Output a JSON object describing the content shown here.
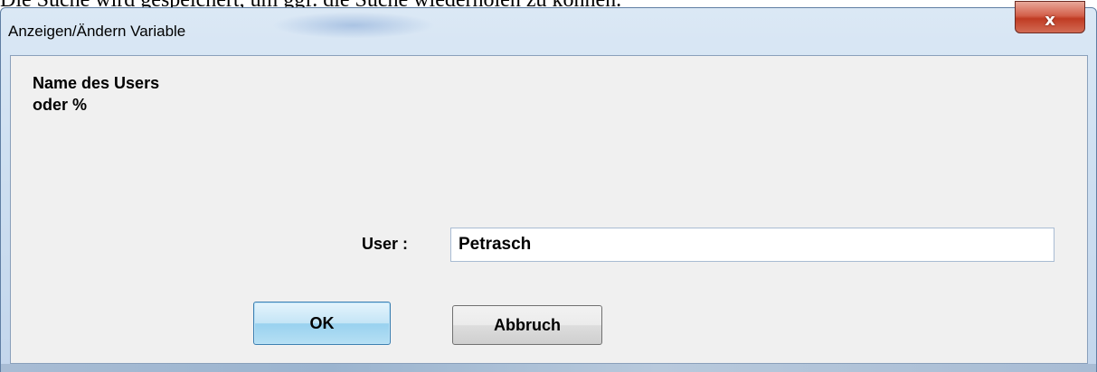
{
  "background": {
    "text": "Die Suche wird gespeichert, um ggf. die Suche wiederholen zu können."
  },
  "window": {
    "title": "Anzeigen/Ändern Variable",
    "close_glyph": "x"
  },
  "dialog": {
    "prompt_line1": "Name des Users",
    "prompt_line2": "oder %",
    "user_label": "User :",
    "user_value": "Petrasch",
    "ok_label": "OK",
    "cancel_label": "Abbruch"
  },
  "colors": {
    "close_button": "#c03b23",
    "ok_button_border": "#3c7fb1",
    "dialog_background": "#f0f0f0"
  }
}
